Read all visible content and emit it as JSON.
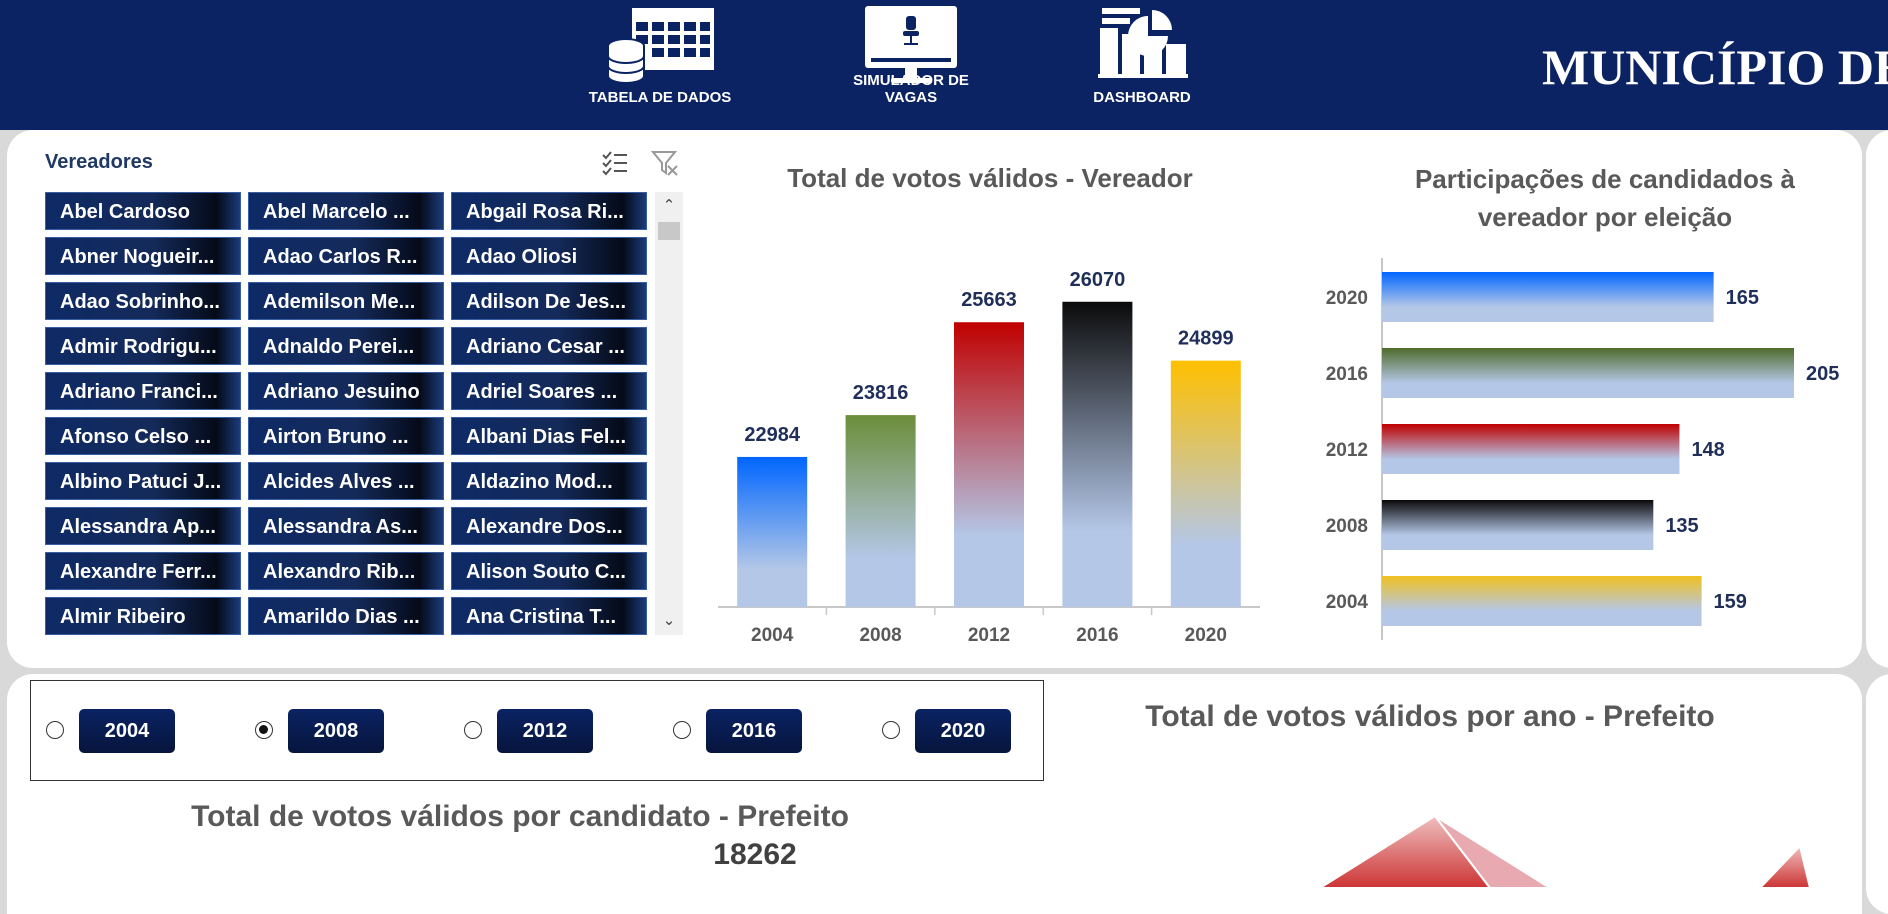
{
  "nav": {
    "items": [
      {
        "label": "TABELA DE DADOS",
        "icon": "database-table-icon"
      },
      {
        "label": "SIMULADOR DE VAGAS",
        "icon": "monitor-chair-icon"
      },
      {
        "label": "DASHBOARD",
        "icon": "dashboard-chart-icon"
      }
    ],
    "title": "MUNICÍPIO DE"
  },
  "slicer": {
    "title": "Vereadores",
    "items": [
      "Abel Cardoso",
      "Abel Marcelo ...",
      "Abgail Rosa Ri...",
      "Abner Nogueir...",
      "Adao Carlos R...",
      "Adao Oliosi",
      "Adao Sobrinho...",
      "Ademilson Me...",
      "Adilson De Jes...",
      "Admir Rodrigu...",
      "Adnaldo Perei...",
      "Adriano Cesar ...",
      "Adriano Franci...",
      "Adriano Jesuino",
      "Adriel Soares ...",
      "Afonso Celso ...",
      "Airton Bruno ...",
      "Albani Dias Fel...",
      "Albino Patuci J...",
      "Alcides Alves ...",
      "Aldazino Mod...",
      "Alessandra Ap...",
      "Alessandra As...",
      "Alexandre Dos...",
      "Alexandre Ferr...",
      "Alexandro Rib...",
      "Alison Souto C...",
      "Almir Ribeiro",
      "Amarildo Dias ...",
      "Ana Cristina T..."
    ],
    "multiselect_icon": "multi-select-icon",
    "clear_filter_icon": "clear-filter-icon"
  },
  "chart_data": [
    {
      "type": "bar",
      "title": "Total de votos válidos - Vereador",
      "categories": [
        "2004",
        "2008",
        "2012",
        "2016",
        "2020"
      ],
      "values": [
        22984,
        23816,
        25663,
        26070,
        24899
      ],
      "colors": [
        "#0066ff",
        "#6b8e3a",
        "#c00000",
        "#0a0a0a",
        "#ffc000"
      ],
      "ylim": [
        20000,
        27000
      ],
      "grid": false
    },
    {
      "type": "bar",
      "orientation": "horizontal",
      "title": "Participações de candidados à vereador por eleição",
      "categories": [
        "2020",
        "2016",
        "2012",
        "2008",
        "2004"
      ],
      "values": [
        165,
        205,
        148,
        135,
        159
      ],
      "colors": [
        "#0066ff",
        "#4f6b2a",
        "#c00000",
        "#0a0a0a",
        "#f0c020"
      ],
      "xlim": [
        0,
        205
      ],
      "grid": false
    }
  ],
  "year_filter": {
    "options": [
      "2004",
      "2008",
      "2012",
      "2016",
      "2020"
    ],
    "selected": "2008"
  },
  "prefeito": {
    "year_chart_title": "Total de votos válidos por ano - Prefeito",
    "candidate_chart_title": "Total de votos válidos por candidato - Prefeito",
    "candidate_total": "18262"
  }
}
